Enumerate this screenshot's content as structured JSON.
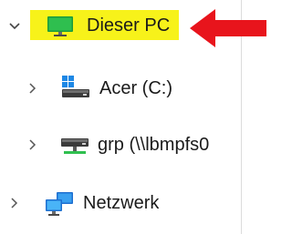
{
  "tree": {
    "items": [
      {
        "label": "Dieser PC",
        "expanded": true,
        "icon": "monitor-icon"
      },
      {
        "label": "Acer (C:)",
        "expanded": false,
        "icon": "windows-drive-icon"
      },
      {
        "label": "grp (\\\\lbmpfs0",
        "expanded": false,
        "icon": "network-drive-icon"
      },
      {
        "label": "Netzwerk",
        "expanded": false,
        "icon": "network-icon"
      }
    ]
  },
  "annotation": {
    "highlight_color": "#f7f21a",
    "arrow_color": "#e8141c",
    "icon": "red-arrow-icon"
  }
}
